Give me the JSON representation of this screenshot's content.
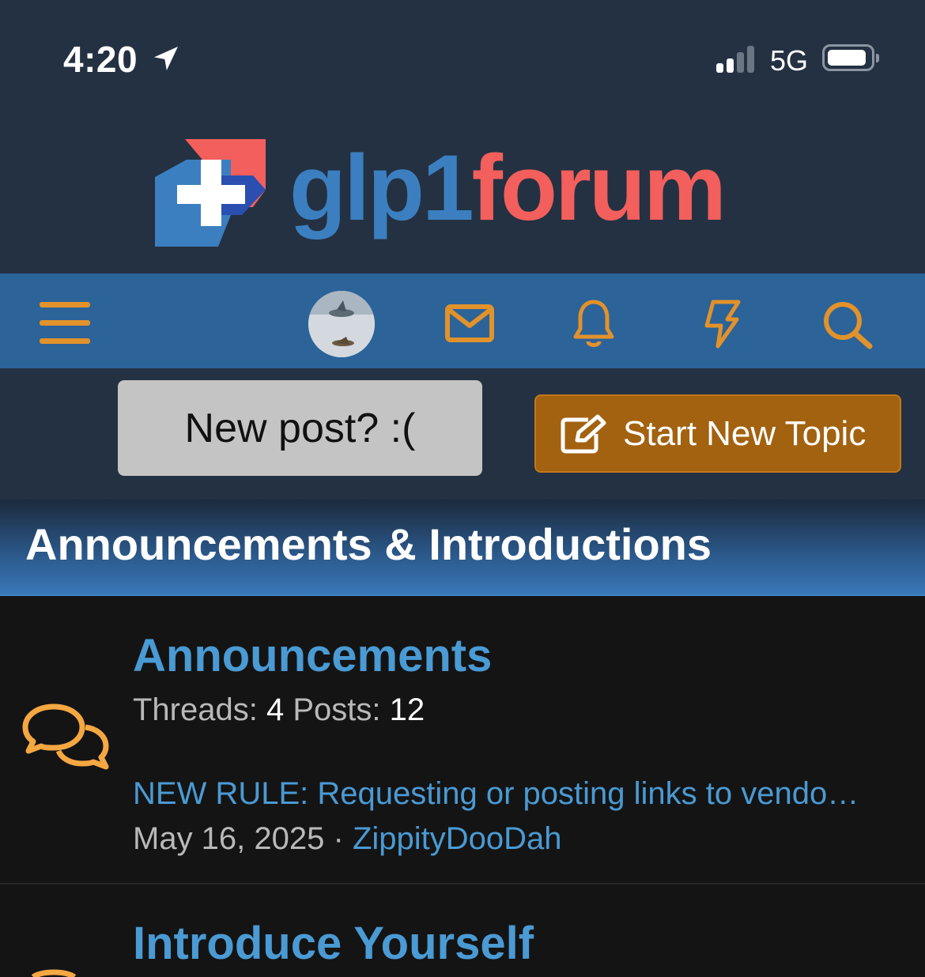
{
  "status_bar": {
    "time": "4:20",
    "network": "5G",
    "icons": [
      "location-arrow-icon",
      "signal-icon",
      "battery-icon"
    ]
  },
  "brand": {
    "logo_part1": "glp1",
    "logo_part2": "forum",
    "colors": {
      "blue": "#3b7fc0",
      "red": "#f25f5c"
    }
  },
  "nav": {
    "icons": [
      "menu-icon",
      "avatar",
      "mail-icon",
      "bell-icon",
      "lightning-icon",
      "search-icon"
    ],
    "accent": "#e2922b",
    "background": "#2c6399"
  },
  "actions": {
    "new_post_label": "New post? :(",
    "start_topic_label": "Start New Topic"
  },
  "section": {
    "title": "Announcements & Introductions"
  },
  "forums": [
    {
      "title": "Announcements",
      "threads_label": "Threads:",
      "threads": "4",
      "posts_label": "Posts:",
      "posts": "12",
      "latest_title": "NEW RULE: Requesting or posting links to vendo…",
      "latest_date": "May 16, 2025",
      "separator": "·",
      "latest_author": "ZippityDooDah"
    },
    {
      "title": "Introduce Yourself"
    }
  ]
}
